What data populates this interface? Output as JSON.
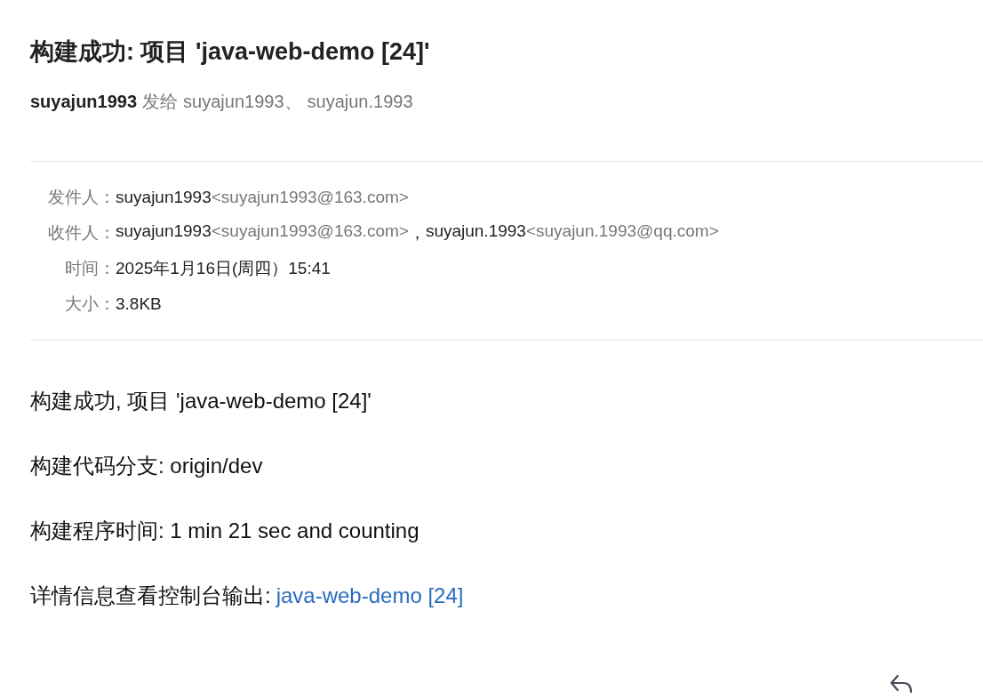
{
  "subject": "构建成功: 项目 'java-web-demo [24]'",
  "summary": {
    "sender": "suyajun1993",
    "verb": "发给",
    "recipients": [
      "suyajun1993、",
      "suyajun.1993"
    ]
  },
  "details": [
    {
      "label": "发件人：",
      "kind": "people",
      "people": [
        {
          "name": "suyajun1993",
          "address": "<suyajun1993@163.com>"
        }
      ]
    },
    {
      "label": "收件人：",
      "kind": "people",
      "separator": "，",
      "people": [
        {
          "name": "suyajun1993",
          "address": "<suyajun1993@163.com>"
        },
        {
          "name": "suyajun.1993",
          "address": "<suyajun.1993@qq.com>"
        }
      ]
    },
    {
      "label": "时间：",
      "kind": "text",
      "value": "2025年1月16日(周四）15:41"
    },
    {
      "label": "大小：",
      "kind": "text",
      "value": "3.8KB"
    }
  ],
  "body": [
    {
      "kind": "text",
      "text": "构建成功, 项目 'java-web-demo [24]'"
    },
    {
      "kind": "text",
      "text": "构建代码分支: origin/dev"
    },
    {
      "kind": "text",
      "text": "构建程序时间: 1 min 21 sec and counting"
    },
    {
      "kind": "link",
      "text": "详情信息查看控制台输出:",
      "link": "java-web-demo [24]"
    }
  ]
}
